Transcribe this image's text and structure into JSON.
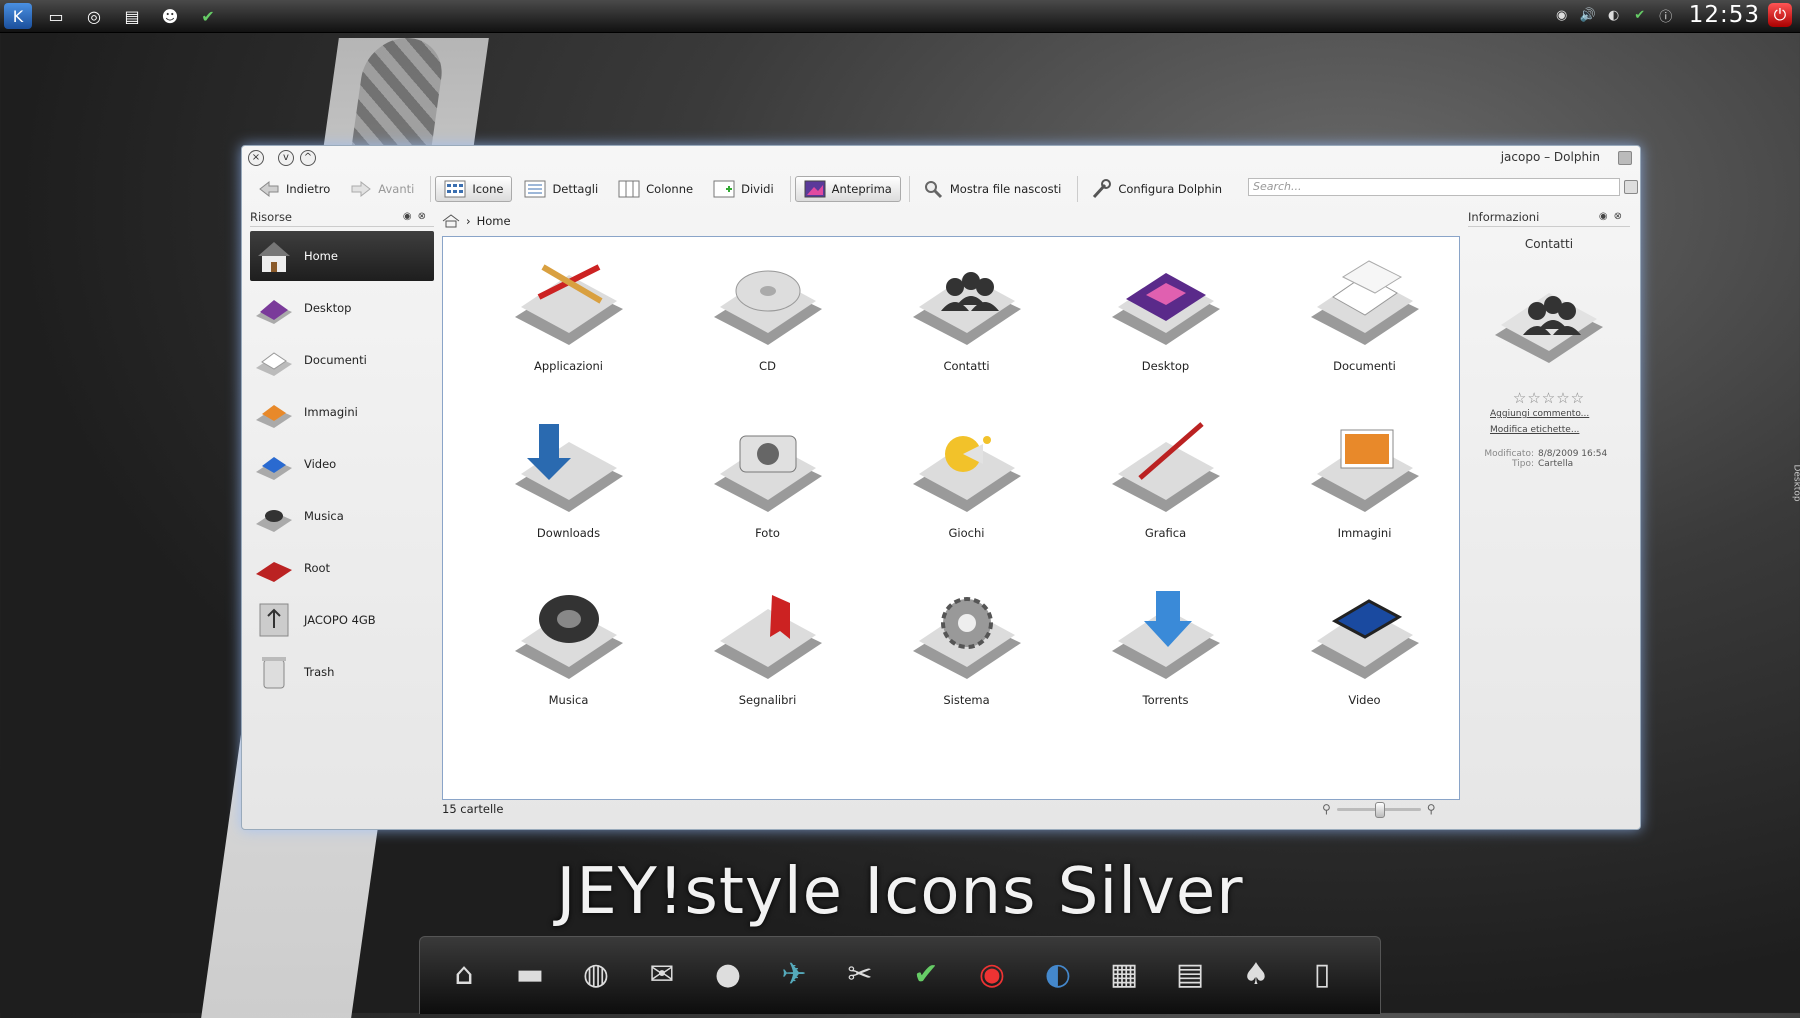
{
  "window": {
    "title": "jacopo – Dolphin"
  },
  "toolbar": {
    "back": "Indietro",
    "forward": "Avanti",
    "icons": "Icone",
    "details": "Dettagli",
    "columns": "Colonne",
    "split": "Dividi",
    "preview": "Anteprima",
    "show_hidden": "Mostra file nascosti",
    "configure": "Configura Dolphin",
    "search_placeholder": "Search..."
  },
  "places": {
    "title": "Risorse",
    "items": [
      "Home",
      "Desktop",
      "Documenti",
      "Immagini",
      "Video",
      "Musica",
      "Root",
      "JACOPO 4GB",
      "Trash"
    ]
  },
  "breadcrumb": {
    "current": "Home"
  },
  "folders": [
    {
      "label": "Applicazioni",
      "icon": "applications-folder-icon"
    },
    {
      "label": "CD",
      "icon": "cd-folder-icon"
    },
    {
      "label": "Contatti",
      "icon": "contacts-folder-icon"
    },
    {
      "label": "Desktop",
      "icon": "desktop-folder-icon"
    },
    {
      "label": "Documenti",
      "icon": "documents-folder-icon"
    },
    {
      "label": "Downloads",
      "icon": "downloads-folder-icon"
    },
    {
      "label": "Foto",
      "icon": "photo-folder-icon"
    },
    {
      "label": "Giochi",
      "icon": "games-folder-icon"
    },
    {
      "label": "Grafica",
      "icon": "graphics-folder-icon"
    },
    {
      "label": "Immagini",
      "icon": "pictures-folder-icon"
    },
    {
      "label": "Musica",
      "icon": "music-folder-icon"
    },
    {
      "label": "Segnalibri",
      "icon": "bookmarks-folder-icon"
    },
    {
      "label": "Sistema",
      "icon": "system-folder-icon"
    },
    {
      "label": "Torrents",
      "icon": "torrents-folder-icon"
    },
    {
      "label": "Video",
      "icon": "video-folder-icon"
    }
  ],
  "status": {
    "count": "15 cartelle"
  },
  "info": {
    "title": "Informazioni",
    "name": "Contatti",
    "add_comment": "Aggiungi commento...",
    "edit_tags": "Modifica etichette...",
    "modified_label": "Modificato:",
    "modified_value": "8/8/2009 16:54",
    "type_label": "Tipo:",
    "type_value": "Cartella"
  },
  "clock": "12:53",
  "brand": "JEY!style Icons Silver",
  "side_tab": "Desktop",
  "colors": {
    "accent": "#8aa4c8",
    "selection": "#2a2a2a"
  }
}
